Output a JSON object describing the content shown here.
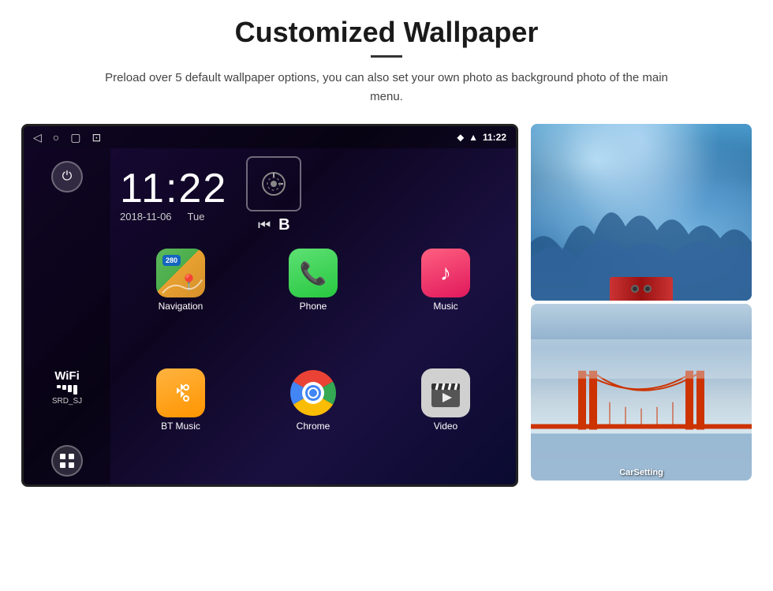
{
  "header": {
    "title": "Customized Wallpaper",
    "subtitle": "Preload over 5 default wallpaper options, you can also set your own photo as background photo of the main menu."
  },
  "screen": {
    "time": "11:22",
    "date": "2018-11-06",
    "day": "Tue",
    "status_time": "11:22",
    "wifi_label": "WiFi",
    "wifi_ssid": "SRD_SJ"
  },
  "apps": [
    {
      "label": "Navigation",
      "icon_type": "nav"
    },
    {
      "label": "Phone",
      "icon_type": "phone"
    },
    {
      "label": "Music",
      "icon_type": "music"
    },
    {
      "label": "BT Music",
      "icon_type": "bt"
    },
    {
      "label": "Chrome",
      "icon_type": "chrome"
    },
    {
      "label": "Video",
      "icon_type": "video"
    }
  ],
  "wallpaper_labels": {
    "carsetting": "CarSetting"
  }
}
